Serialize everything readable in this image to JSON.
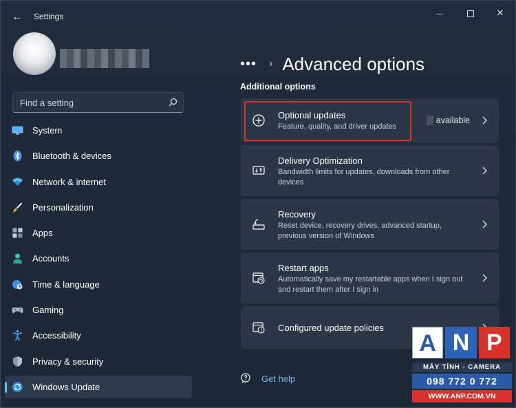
{
  "window": {
    "app_title": "Settings",
    "back_glyph": "←",
    "minimize_glyph": "—",
    "close_glyph": "✕"
  },
  "search": {
    "placeholder": "Find a setting"
  },
  "sidebar": {
    "items": [
      {
        "label": "System",
        "icon": "monitor-icon"
      },
      {
        "label": "Bluetooth & devices",
        "icon": "bluetooth-icon"
      },
      {
        "label": "Network & internet",
        "icon": "wifi-icon"
      },
      {
        "label": "Personalization",
        "icon": "brush-icon"
      },
      {
        "label": "Apps",
        "icon": "apps-icon"
      },
      {
        "label": "Accounts",
        "icon": "person-icon"
      },
      {
        "label": "Time & language",
        "icon": "globe-clock-icon"
      },
      {
        "label": "Gaming",
        "icon": "gamepad-icon"
      },
      {
        "label": "Accessibility",
        "icon": "accessibility-icon"
      },
      {
        "label": "Privacy & security",
        "icon": "shield-icon"
      },
      {
        "label": "Windows Update",
        "icon": "update-icon",
        "selected": true
      }
    ]
  },
  "main": {
    "breadcrumb_ellipsis": "•••",
    "breadcrumb_separator": "›",
    "page_title": "Advanced options",
    "section_title": "Additional options",
    "cards": [
      {
        "title": "Optional updates",
        "desc": "Feature, quality, and driver updates",
        "status": "available",
        "icon": "plus-circle-icon"
      },
      {
        "title": "Delivery Optimization",
        "desc": "Bandwidth limits for updates, downloads from other devices",
        "icon": "delivery-icon"
      },
      {
        "title": "Recovery",
        "desc": "Reset device, recovery drives, advanced startup, previous version of Windows",
        "icon": "recovery-icon"
      },
      {
        "title": "Restart apps",
        "desc": "Automatically save my restartable apps when I sign out and restart them after I sign in",
        "icon": "restart-apps-icon"
      },
      {
        "title": "Configured update policies",
        "desc": "",
        "icon": "policy-icon"
      }
    ],
    "help_label": "Get help"
  },
  "watermark": {
    "letters": [
      "A",
      "N",
      "P"
    ],
    "subtitle": "MÁY TÍNH - CAMERA",
    "phone": "098 772 0 772",
    "website": "WWW.ANP.COM.VN"
  },
  "colors": {
    "accent": "#4cc2ff",
    "highlight_border": "#e02b2b",
    "link": "#76b9f0"
  }
}
